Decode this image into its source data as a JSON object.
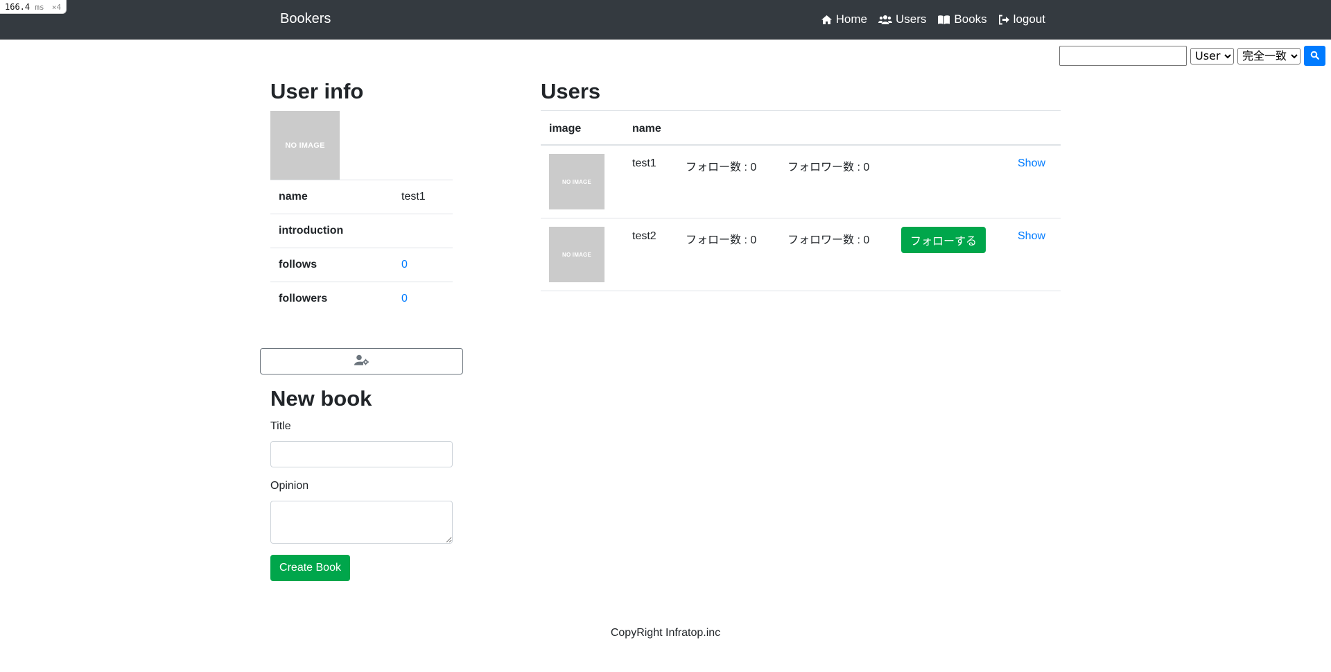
{
  "perf": {
    "value": "166.4",
    "unit": "ms",
    "multiplier": "×4"
  },
  "navbar": {
    "brand": "Bookers",
    "links": [
      {
        "label": "Home",
        "icon": "home-icon"
      },
      {
        "label": "Users",
        "icon": "users-icon"
      },
      {
        "label": "Books",
        "icon": "book-open-icon"
      },
      {
        "label": "logout",
        "icon": "sign-out-icon"
      }
    ]
  },
  "search": {
    "value": "",
    "target_options": [
      "User"
    ],
    "target_selected": "User",
    "match_options": [
      "完全一致"
    ],
    "match_selected": "完全一致",
    "button_icon": "search-icon"
  },
  "user_info": {
    "title": "User info",
    "avatar_text": "NO IMAGE",
    "rows": [
      {
        "key": "name",
        "value": "test1"
      },
      {
        "key": "introduction",
        "value": ""
      },
      {
        "key": "follows",
        "value": "0"
      },
      {
        "key": "followers",
        "value": "0"
      }
    ],
    "settings_icon": "user-cog-icon"
  },
  "new_book": {
    "title": "New book",
    "title_label": "Title",
    "title_value": "",
    "opinion_label": "Opinion",
    "opinion_value": "",
    "submit_label": "Create Book"
  },
  "users": {
    "title": "Users",
    "headers": {
      "image": "image",
      "name": "name"
    },
    "rows": [
      {
        "image_text": "NO IMAGE",
        "name": "test1",
        "follows": "フォロー数 : 0",
        "followers": "フォロワー数 : 0",
        "follow_label": "",
        "show": "Show"
      },
      {
        "image_text": "NO IMAGE",
        "name": "test2",
        "follows": "フォロー数 : 0",
        "followers": "フォロワー数 : 0",
        "follow_label": "フォローする",
        "show": "Show"
      }
    ]
  },
  "footer": {
    "text": "CopyRight Infratop.inc"
  },
  "colors": {
    "navbar": "#343a40",
    "link": "#007bff",
    "success": "#00a64b",
    "no_image_bg": "#cbcbcb"
  }
}
